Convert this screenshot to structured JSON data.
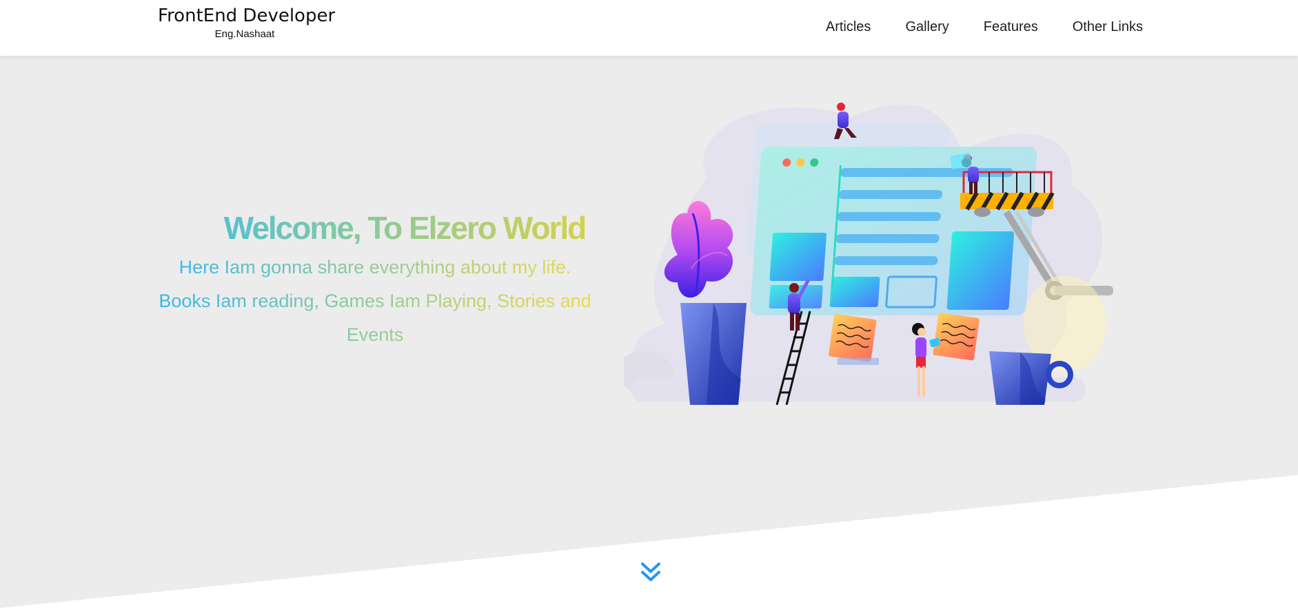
{
  "header": {
    "logo_title": "FrontEnd Developer",
    "logo_subtitle": "Eng.Nashaat",
    "nav": [
      {
        "label": "Articles"
      },
      {
        "label": "Gallery"
      },
      {
        "label": "Features"
      },
      {
        "label": "Other Links"
      }
    ]
  },
  "hero": {
    "title": "Welcome, To Elzero World",
    "description": "Here Iam gonna share everything about my life. Books Iam reading, Games Iam Playing, Stories and Events",
    "illustration_icon": "web-development-illustration",
    "scroll_icon": "double-chevron-down-icon"
  },
  "colors": {
    "hero_background": "#ececec",
    "accent_blue": "#2196f3",
    "gradient_start": "#3ebbe8",
    "gradient_end": "#e6d84a"
  }
}
